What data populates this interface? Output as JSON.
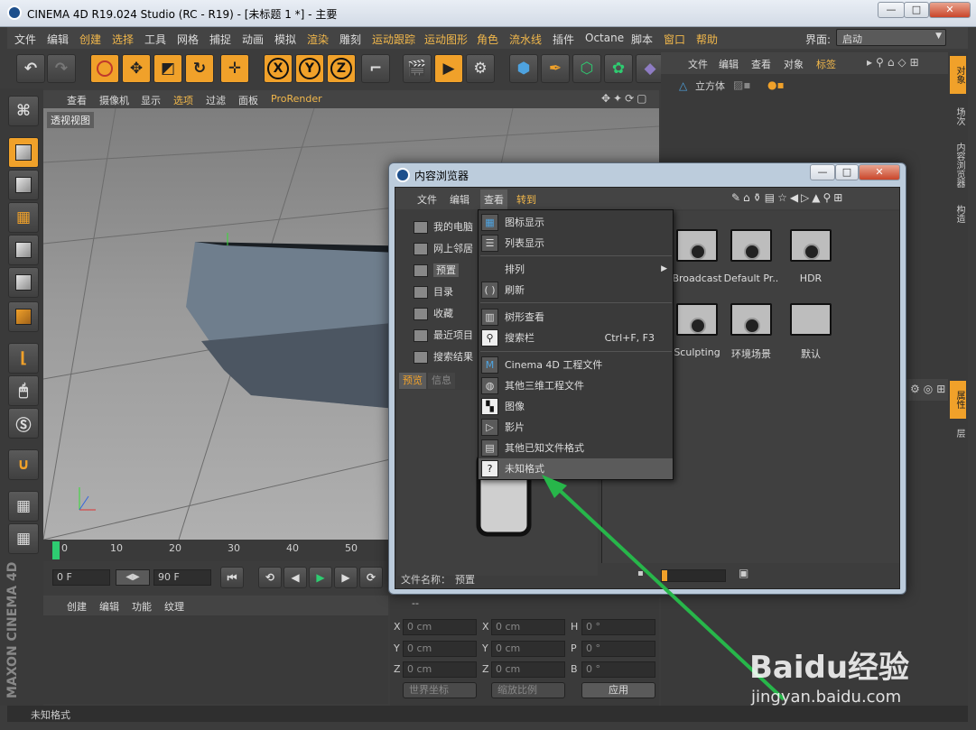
{
  "window": {
    "title": "CINEMA 4D R19.024 Studio (RC - R19) - [未标题 1 *] - 主要",
    "btn_min": "—",
    "btn_max": "□",
    "btn_close": "✕"
  },
  "menubar": {
    "items": [
      "文件",
      "编辑",
      "创建",
      "选择",
      "工具",
      "网格",
      "捕捉",
      "动画",
      "模拟",
      "渲染",
      "雕刻",
      "运动跟踪",
      "运动图形",
      "角色",
      "流水线",
      "插件",
      "Octane",
      "脚本",
      "窗口",
      "帮助"
    ],
    "layout_label": "界面:",
    "layout_value": "启动"
  },
  "viewport": {
    "menu": [
      "查看",
      "摄像机",
      "显示",
      "选项",
      "过滤",
      "面板",
      "ProRender"
    ],
    "label": "透视视图"
  },
  "timeline": {
    "ticks": [
      "0",
      "10",
      "20",
      "30",
      "40",
      "50"
    ],
    "frame_start": "0 F",
    "frame_end": "90 F"
  },
  "material": {
    "menu": [
      "创建",
      "编辑",
      "功能",
      "纹理"
    ]
  },
  "object_manager": {
    "menu": [
      "文件",
      "编辑",
      "查看",
      "对象",
      "标签"
    ],
    "object_name": "立方体"
  },
  "right_tabs": {
    "tab1": "对象",
    "tab2": "场次",
    "tab3": "内容浏览器",
    "tab4": "构造",
    "tab5": "属性",
    "tab6": "层"
  },
  "coords": {
    "labels": [
      "X",
      "Y",
      "Z"
    ],
    "labels2": [
      "H",
      "P",
      "B"
    ],
    "pos": "0 cm",
    "rot": "0 °",
    "world": "世界坐标",
    "scale": "缩放比例",
    "apply": "应用",
    "col_header": "--"
  },
  "dialog": {
    "title": "内容浏览器",
    "menu": [
      "文件",
      "编辑",
      "查看",
      "转到"
    ],
    "tree": [
      "我的电脑",
      "网上邻居",
      "预置",
      "目录",
      "收藏",
      "最近项目",
      "搜索结果"
    ],
    "tabs": [
      "预览",
      "信息"
    ],
    "folders": [
      "Broadcast",
      "Default Pr..",
      "HDR",
      "Sculpting",
      "环境场景",
      "默认"
    ],
    "filename_label": "文件名称：",
    "filename_value": "预置"
  },
  "dropdown": {
    "items": [
      {
        "label": "图标显示",
        "icon": "grid-icon"
      },
      {
        "label": "列表显示",
        "icon": "list-icon"
      },
      {
        "label": "排列",
        "icon": "none"
      },
      {
        "label": "刷新",
        "icon": "refresh-icon"
      },
      {
        "label": "树形查看",
        "icon": "tree-icon"
      },
      {
        "label": "搜索栏",
        "icon": "search-icon",
        "shortcut": "Ctrl+F, F3"
      },
      {
        "label": "Cinema 4D 工程文件",
        "icon": "c4d-file-icon"
      },
      {
        "label": "其他三维工程文件",
        "icon": "sphere-icon"
      },
      {
        "label": "图像",
        "icon": "checker-icon"
      },
      {
        "label": "影片",
        "icon": "play-icon"
      },
      {
        "label": "其他已知文件格式",
        "icon": "doc-icon"
      },
      {
        "label": "未知格式",
        "icon": "unknown-icon"
      }
    ]
  },
  "statusbar": {
    "text": "未知格式"
  },
  "watermark": {
    "text1": "Baidu经验",
    "text2": "jingyan.baidu.com"
  },
  "side_brand": {
    "text": "MAXON CINEMA 4D"
  }
}
